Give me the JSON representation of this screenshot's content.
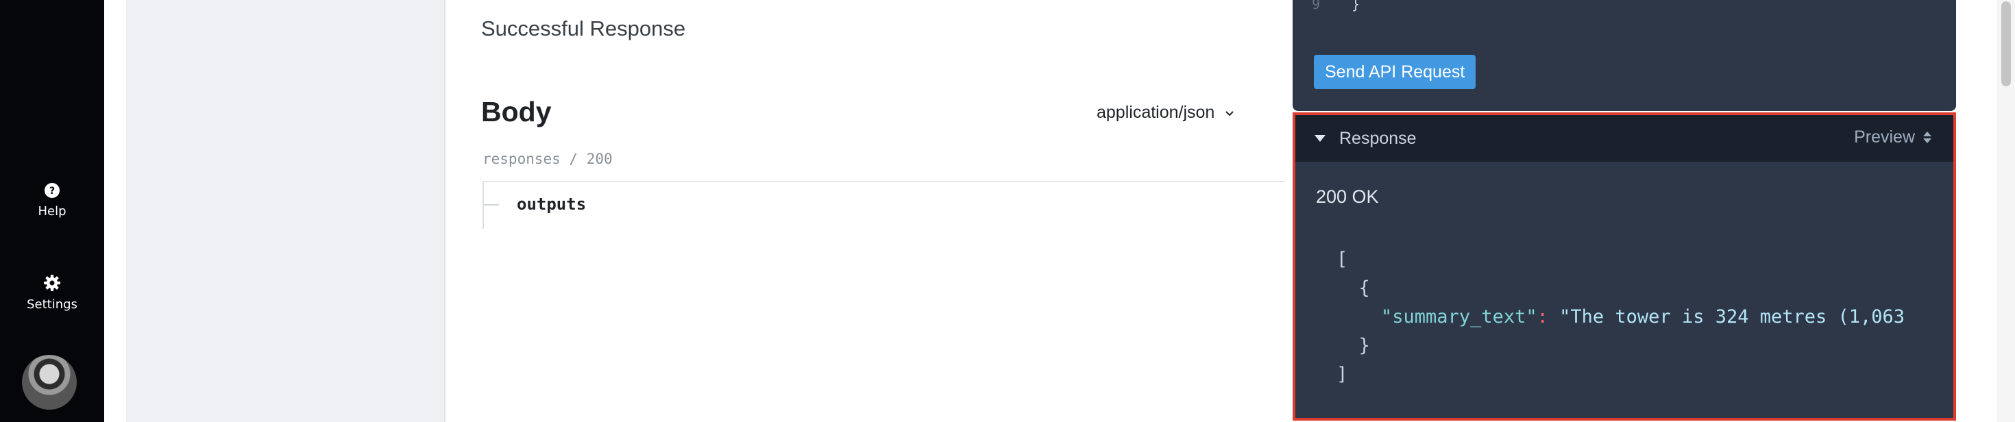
{
  "rail": {
    "help_label": "Help",
    "settings_label": "Settings"
  },
  "main": {
    "response_title": "Successful Response",
    "body_title": "Body",
    "content_type": "application/json",
    "breadcrumb": "responses / 200",
    "property": "outputs"
  },
  "console": {
    "line_number": "9",
    "code_line": "}",
    "send_button": "Send API Request",
    "response_label": "Response",
    "preview_label": "Preview",
    "status": "200 OK",
    "json": {
      "open_bracket": "[",
      "open_brace": "{",
      "key": "\"summary_text\"",
      "colon": ":",
      "value": "\"The tower is 324 metres (1,063",
      "close_brace": "}",
      "close_bracket": "]"
    }
  },
  "colors": {
    "accent": "#4299e1",
    "highlight_border": "#dc3e2f",
    "console_bg": "#2d3748"
  }
}
